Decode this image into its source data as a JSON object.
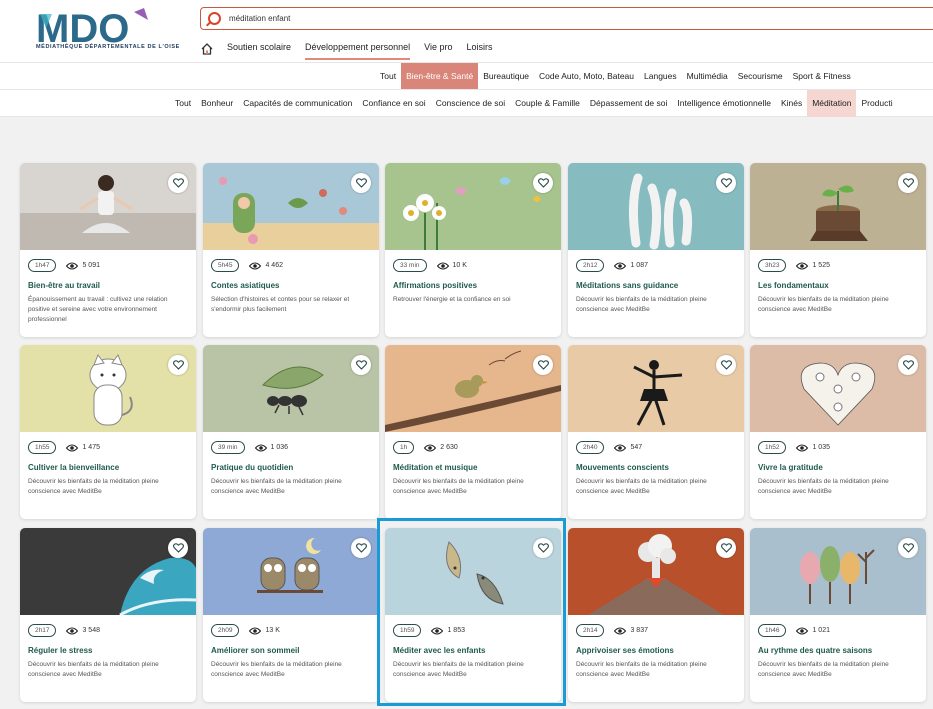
{
  "header": {
    "logo_text": "MDO",
    "logo_subtitle": "MÉDIATHÈQUE DÉPARTEMENTALE DE L'OISE",
    "search_value": "méditation enfant",
    "nav": [
      "Soutien scolaire",
      "Développement personnel",
      "Vie pro",
      "Loisirs"
    ],
    "nav_active": 1
  },
  "categories": {
    "row1": [
      "Tout",
      "Bien-être & Santé",
      "Bureautique",
      "Code Auto, Moto, Bateau",
      "Langues",
      "Multimédia",
      "Secourisme",
      "Sport & Fitness"
    ],
    "row1_active": 1,
    "row2": [
      "Tout",
      "Bonheur",
      "Capacités de communication",
      "Confiance en soi",
      "Conscience de soi",
      "Couple & Famille",
      "Dépassement de soi",
      "Intelligence émotionnelle",
      "Kinés",
      "Méditation",
      "Producti"
    ],
    "row2_active": 9
  },
  "cards": [
    {
      "duration": "1h47",
      "views": "5 091",
      "title": "Bien-être au travail",
      "desc": "Épanouissement au travail : cultivez une relation positive et sereine avec votre environnement professionnel",
      "bg": "#d8d4cf",
      "icon": "woman-meditating"
    },
    {
      "duration": "5h45",
      "views": "4 462",
      "title": "Contes asiatiques",
      "desc": "Sélection d'histoires et contes pour se relaxer et s'endormir plus facilement",
      "bg": "#a8c8d8",
      "icon": "fairy-tale"
    },
    {
      "duration": "33 min",
      "views": "10 K",
      "title": "Affirmations positives",
      "desc": "Retrouver l'énergie et la confiance en soi",
      "bg": "#a7c48e",
      "icon": "flowers-butterflies"
    },
    {
      "duration": "2h12",
      "views": "1 087",
      "title": "Méditations sans guidance",
      "desc": "Découvrir les bienfaits de la méditation pleine conscience avec MeditBe",
      "bg": "#86bcc0",
      "icon": "sea-worms"
    },
    {
      "duration": "3h23",
      "views": "1 525",
      "title": "Les fondamentaux",
      "desc": "Découvrir les bienfaits de la méditation pleine conscience avec MeditBe",
      "bg": "#bdb194",
      "icon": "tree-stump"
    },
    {
      "duration": "1h55",
      "views": "1 475",
      "title": "Cultiver la bienveillance",
      "desc": "Découvrir les bienfaits de la méditation pleine conscience avec MeditBe",
      "bg": "#e3e0a8",
      "icon": "cat"
    },
    {
      "duration": "39 min",
      "views": "1 036",
      "title": "Pratique du quotidien",
      "desc": "Découvrir les bienfaits de la méditation pleine conscience avec MeditBe",
      "bg": "#b9c4a6",
      "icon": "ant-leaf"
    },
    {
      "duration": "1h",
      "views": "2 630",
      "title": "Méditation et musique",
      "desc": "Découvrir les bienfaits de la méditation pleine conscience avec MeditBe",
      "bg": "#e6b68d",
      "icon": "bird-branch"
    },
    {
      "duration": "2h40",
      "views": "547",
      "title": "Mouvements conscients",
      "desc": "Découvrir les bienfaits de la méditation pleine conscience avec MeditBe",
      "bg": "#e8cba6",
      "icon": "dancer"
    },
    {
      "duration": "1h52",
      "views": "1 035",
      "title": "Vivre la gratitude",
      "desc": "Découvrir les bienfaits de la méditation pleine conscience avec MeditBe",
      "bg": "#dcbca6",
      "icon": "flower-heart"
    },
    {
      "duration": "2h17",
      "views": "3 548",
      "title": "Réguler le stress",
      "desc": "Découvrir les bienfaits de la méditation pleine conscience avec MeditBe",
      "bg": "#3a3a3a",
      "icon": "wave"
    },
    {
      "duration": "2h09",
      "views": "13 K",
      "title": "Améliorer son sommeil",
      "desc": "Découvrir les bienfaits de la méditation pleine conscience avec MeditBe",
      "bg": "#8ea9d6",
      "icon": "owls-moon"
    },
    {
      "duration": "1h59",
      "views": "1 853",
      "title": "Méditer avec les enfants",
      "desc": "Découvrir les bienfaits de la méditation pleine conscience avec MeditBe",
      "bg": "#b9d4dd",
      "icon": "fishes"
    },
    {
      "duration": "2h14",
      "views": "3 837",
      "title": "Apprivoiser ses émotions",
      "desc": "Découvrir les bienfaits de la méditation pleine conscience avec MeditBe",
      "bg": "#b8502c",
      "icon": "volcano"
    },
    {
      "duration": "1h46",
      "views": "1 021",
      "title": "Au rythme des quatre saisons",
      "desc": "Découvrir les bienfaits de la méditation pleine conscience avec MeditBe",
      "bg": "#a9bfce",
      "icon": "four-trees"
    }
  ],
  "colors": {
    "accent": "#d98579",
    "title_green": "#1e5a4c",
    "highlight": "#1a9bd6"
  }
}
